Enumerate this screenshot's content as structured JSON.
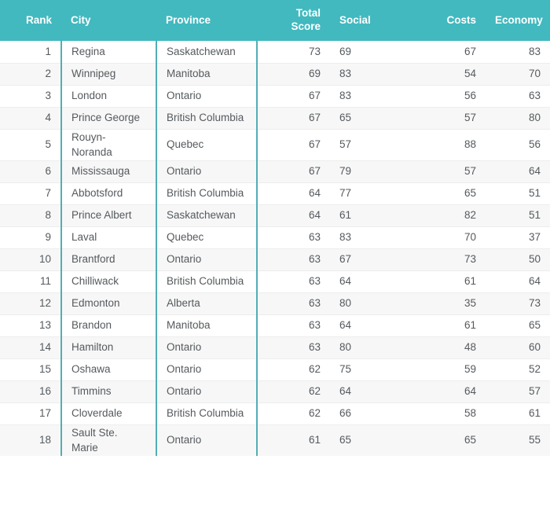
{
  "table": {
    "name": "canada-best-cities-ranking-table",
    "accent_color": "#41b9bf",
    "divider_color": "#52aeb4",
    "row_rule_color": "#eceded",
    "stripe_color": "#f7f7f7",
    "text_color": "#555a5e",
    "header_text_color": "#ffffff",
    "columns": [
      {
        "key": "rank",
        "label": "Rank",
        "align": "right"
      },
      {
        "key": "city",
        "label": "City",
        "align": "left"
      },
      {
        "key": "province",
        "label": "Province",
        "align": "left"
      },
      {
        "key": "total",
        "label": "Total Score",
        "align": "right"
      },
      {
        "key": "social",
        "label": "Social",
        "align": "left"
      },
      {
        "key": "costs",
        "label": "Costs",
        "align": "right"
      },
      {
        "key": "economy",
        "label": "Economy",
        "align": "right"
      }
    ],
    "rows": [
      {
        "rank": "1",
        "city": "Regina",
        "province": "Saskatchewan",
        "total": "73",
        "social": "69",
        "costs": "67",
        "economy": "83"
      },
      {
        "rank": "2",
        "city": "Winnipeg",
        "province": "Manitoba",
        "total": "69",
        "social": "83",
        "costs": "54",
        "economy": "70"
      },
      {
        "rank": "3",
        "city": "London",
        "province": "Ontario",
        "total": "67",
        "social": "83",
        "costs": "56",
        "economy": "63"
      },
      {
        "rank": "4",
        "city": "Prince George",
        "province": "British Columbia",
        "total": "67",
        "social": "65",
        "costs": "57",
        "economy": "80"
      },
      {
        "rank": "5",
        "city": "Rouyn-Noranda",
        "province": "Quebec",
        "total": "67",
        "social": "57",
        "costs": "88",
        "economy": "56"
      },
      {
        "rank": "6",
        "city": "Mississauga",
        "province": "Ontario",
        "total": "67",
        "social": "79",
        "costs": "57",
        "economy": "64"
      },
      {
        "rank": "7",
        "city": "Abbotsford",
        "province": "British Columbia",
        "total": "64",
        "social": "77",
        "costs": "65",
        "economy": "51"
      },
      {
        "rank": "8",
        "city": "Prince Albert",
        "province": "Saskatchewan",
        "total": "64",
        "social": "61",
        "costs": "82",
        "economy": "51"
      },
      {
        "rank": "9",
        "city": "Laval",
        "province": "Quebec",
        "total": "63",
        "social": "83",
        "costs": "70",
        "economy": "37"
      },
      {
        "rank": "10",
        "city": "Brantford",
        "province": "Ontario",
        "total": "63",
        "social": "67",
        "costs": "73",
        "economy": "50"
      },
      {
        "rank": "11",
        "city": "Chilliwack",
        "province": "British Columbia",
        "total": "63",
        "social": "64",
        "costs": "61",
        "economy": "64"
      },
      {
        "rank": "12",
        "city": "Edmonton",
        "province": "Alberta",
        "total": "63",
        "social": "80",
        "costs": "35",
        "economy": "73"
      },
      {
        "rank": "13",
        "city": "Brandon",
        "province": "Manitoba",
        "total": "63",
        "social": "64",
        "costs": "61",
        "economy": "65"
      },
      {
        "rank": "14",
        "city": "Hamilton",
        "province": "Ontario",
        "total": "63",
        "social": "80",
        "costs": "48",
        "economy": "60"
      },
      {
        "rank": "15",
        "city": "Oshawa",
        "province": "Ontario",
        "total": "62",
        "social": "75",
        "costs": "59",
        "economy": "52"
      },
      {
        "rank": "16",
        "city": "Timmins",
        "province": "Ontario",
        "total": "62",
        "social": "64",
        "costs": "64",
        "economy": "57"
      },
      {
        "rank": "17",
        "city": "Cloverdale",
        "province": "British Columbia",
        "total": "62",
        "social": "66",
        "costs": "58",
        "economy": "61"
      },
      {
        "rank": "18",
        "city": "Sault Ste. Marie",
        "province": "Ontario",
        "total": "61",
        "social": "65",
        "costs": "65",
        "economy": "55"
      }
    ]
  }
}
